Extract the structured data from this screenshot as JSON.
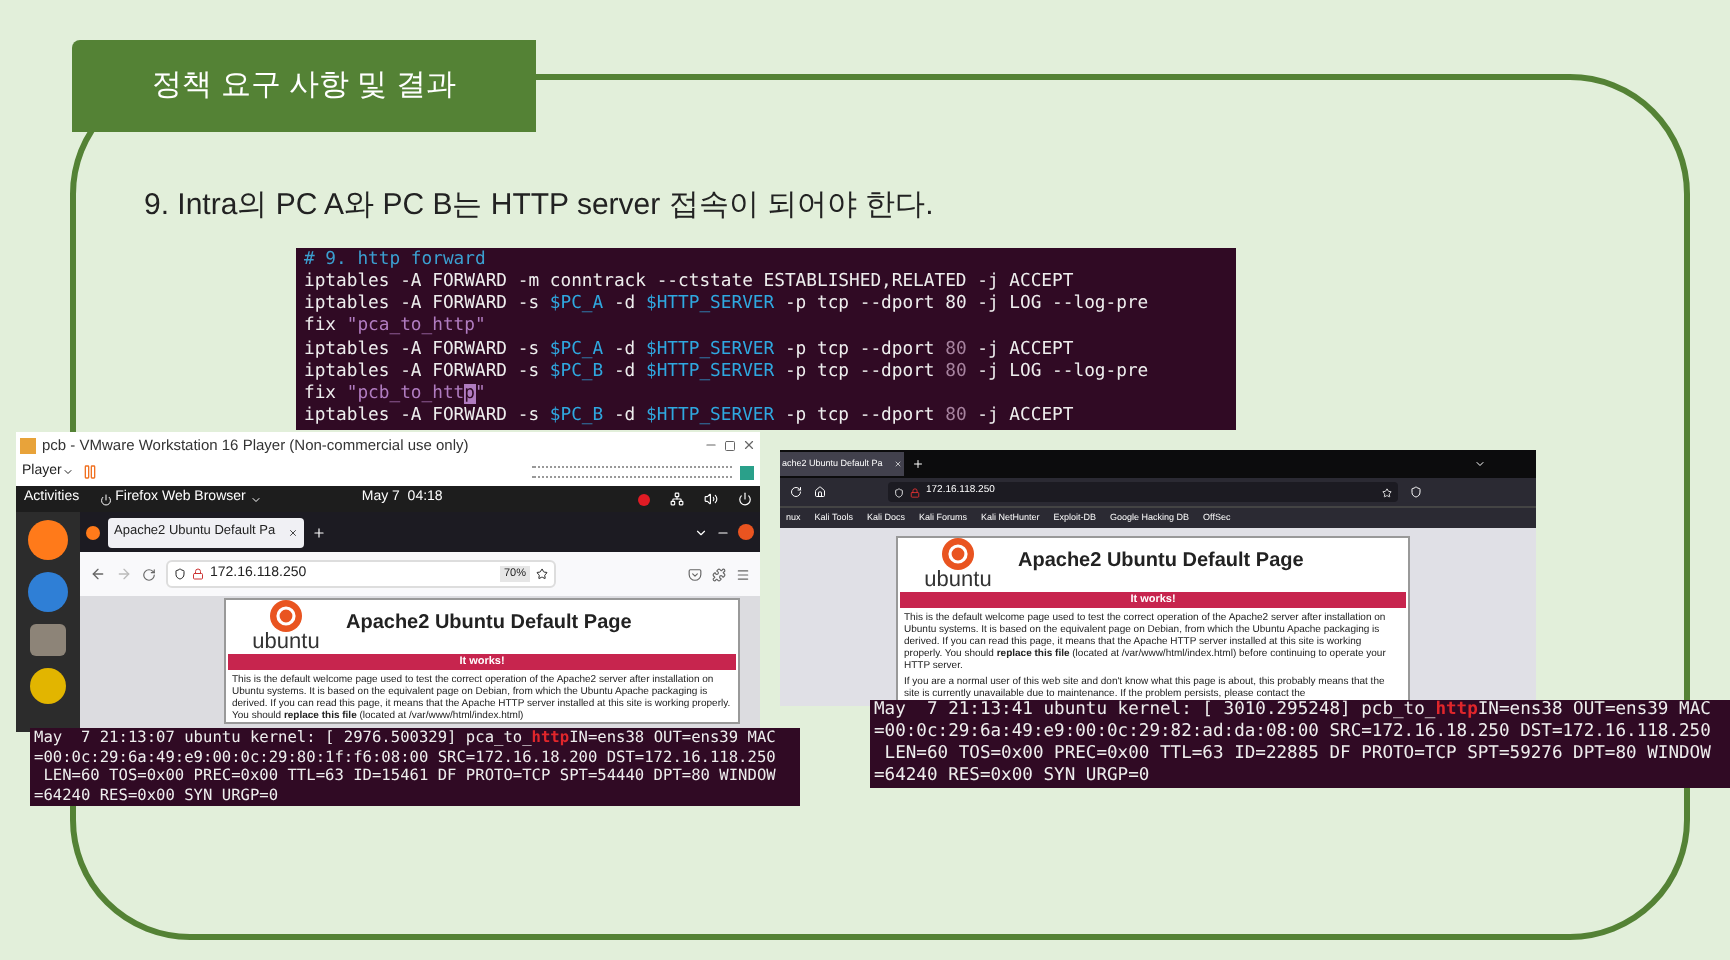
{
  "tab_title": "정책 요구 사항 및 결과",
  "requirement": "9. Intra의 PC A와 PC B는 HTTP server 접속이 되어야 한다.",
  "terminal": {
    "lines": [
      [
        {
          "kind": "comment",
          "text": "# 9. http forward"
        }
      ],
      [
        {
          "kind": "plain",
          "text": "iptables -A FORWARD -m conntrack --ctstate ESTABLISHED,RELATED -j ACCEPT"
        }
      ],
      [
        {
          "kind": "plain",
          "text": "iptables -A FORWARD -s "
        },
        {
          "kind": "variable",
          "text": "$PC_A"
        },
        {
          "kind": "plain",
          "text": " -d "
        },
        {
          "kind": "variable",
          "text": "$HTTP_SERVER"
        },
        {
          "kind": "plain",
          "text": " -p tcp --dport 80 -j LOG --log-pre"
        }
      ],
      [
        {
          "kind": "plain",
          "text": "fix "
        },
        {
          "kind": "string",
          "text": "\"pca_to_http\""
        }
      ],
      [
        {
          "kind": "plain",
          "text": "iptables -A FORWARD -s "
        },
        {
          "kind": "variable",
          "text": "$PC_A"
        },
        {
          "kind": "plain",
          "text": " -d "
        },
        {
          "kind": "variable",
          "text": "$HTTP_SERVER"
        },
        {
          "kind": "plain",
          "text": " -p tcp --dport "
        },
        {
          "kind": "number",
          "text": "80"
        },
        {
          "kind": "plain",
          "text": " -j ACCEPT"
        }
      ],
      [
        {
          "kind": "plain",
          "text": "iptables -A FORWARD -s "
        },
        {
          "kind": "variable",
          "text": "$PC_B"
        },
        {
          "kind": "plain",
          "text": " -d "
        },
        {
          "kind": "variable",
          "text": "$HTTP_SERVER"
        },
        {
          "kind": "plain",
          "text": " -p tcp --dport "
        },
        {
          "kind": "number",
          "text": "80"
        },
        {
          "kind": "plain",
          "text": " -j LOG --log-pre"
        }
      ],
      [
        {
          "kind": "plain",
          "text": "fix "
        },
        {
          "kind": "string",
          "text": "\"pcb_to_htt"
        },
        {
          "kind": "cursor",
          "text": "p"
        },
        {
          "kind": "string",
          "text": "\""
        }
      ],
      [
        {
          "kind": "plain",
          "text": "iptables -A FORWARD -s "
        },
        {
          "kind": "variable",
          "text": "$PC_B"
        },
        {
          "kind": "plain",
          "text": " -d "
        },
        {
          "kind": "variable",
          "text": "$HTTP_SERVER"
        },
        {
          "kind": "plain",
          "text": " -p tcp --dport "
        },
        {
          "kind": "number",
          "text": "80"
        },
        {
          "kind": "plain",
          "text": " -j ACCEPT"
        }
      ]
    ]
  },
  "vm_window": {
    "title": "pcb - VMware Workstation 16 Player (Non-commercial use only)",
    "menu": "Player",
    "top_bar": {
      "activities": "Activities",
      "app": "Firefox Web Browser",
      "clock": "May 7  04:18"
    },
    "browser": {
      "tab": "Apache2 Ubuntu Default Pa",
      "url": "172.16.118.250",
      "zoom": "70%"
    },
    "page": {
      "heading": "Apache2 Ubuntu Default Page",
      "logo_text": "ubuntu",
      "banner": "It works!",
      "paragraphs": [
        "This is the default welcome page used to test the correct operation of the Apache2 server after installation on Ubuntu systems. It is based on the equivalent page on Debian, from which the Ubuntu Apache packaging is derived. If you can read this page, it means that the Apache HTTP server installed at this site is working properly. You should **replace this file** (located at /var/www/html/index.html)"
      ]
    }
  },
  "vm_log": {
    "lines": [
      [
        {
          "kind": "plain",
          "text": "May  7 21:13:07 ubuntu kernel: [ 2976.500329] pca_to_"
        },
        {
          "kind": "match",
          "text": "http"
        },
        {
          "kind": "plain",
          "text": "IN=ens38 OUT=ens39 MAC"
        }
      ],
      [
        {
          "kind": "plain",
          "text": "=00:0c:29:6a:49:e9:00:0c:29:80:1f:f6:08:00 SRC=172.16.18.200 DST=172.16.118.250"
        }
      ],
      [
        {
          "kind": "plain",
          "text": " LEN=60 TOS=0x00 PREC=0x00 TTL=63 ID=15461 DF PROTO=TCP SPT=54440 DPT=80 WINDOW"
        }
      ],
      [
        {
          "kind": "plain",
          "text": "=64240 RES=0x00 SYN URGP=0"
        }
      ]
    ]
  },
  "kali_browser": {
    "tab": "ache2 Ubuntu Default Pa",
    "url": "172.16.118.250",
    "bookmarks": [
      "nux",
      "Kali Tools",
      "Kali Docs",
      "Kali Forums",
      "Kali NetHunter",
      "Exploit-DB",
      "Google Hacking DB",
      "OffSec"
    ],
    "page": {
      "heading": "Apache2 Ubuntu Default Page",
      "logo_text": "ubuntu",
      "banner": "It works!",
      "paragraphs": [
        "This is the default welcome page used to test the correct operation of the Apache2 server after installation on Ubuntu systems. It is based on the equivalent page on Debian, from which the Ubuntu Apache packaging is derived. If you can read this page, it means that the Apache HTTP server installed at this site is working properly. You should **replace this file** (located at /var/www/html/index.html) before continuing to operate your HTTP server.",
        "If you are a normal user of this web site and don't know what this page is about, this probably means that the site is currently unavailable due to maintenance. If the problem persists, please contact the"
      ]
    }
  },
  "kali_log": {
    "lines": [
      [
        {
          "kind": "plain",
          "text": "May  7 21:13:41 ubuntu kernel: [ 3010.295248] pcb_to_"
        },
        {
          "kind": "match",
          "text": "http"
        },
        {
          "kind": "plain",
          "text": "IN=ens38 OUT=ens39 MAC"
        }
      ],
      [
        {
          "kind": "plain",
          "text": "=00:0c:29:6a:49:e9:00:0c:29:82:ad:da:08:00 SRC=172.16.18.250 DST=172.16.118.250"
        }
      ],
      [
        {
          "kind": "plain",
          "text": " LEN=60 TOS=0x00 PREC=0x00 TTL=63 ID=22885 DF PROTO=TCP SPT=59276 DPT=80 WINDOW"
        }
      ],
      [
        {
          "kind": "plain",
          "text": "=64240 RES=0x00 SYN URGP=0"
        }
      ]
    ]
  }
}
